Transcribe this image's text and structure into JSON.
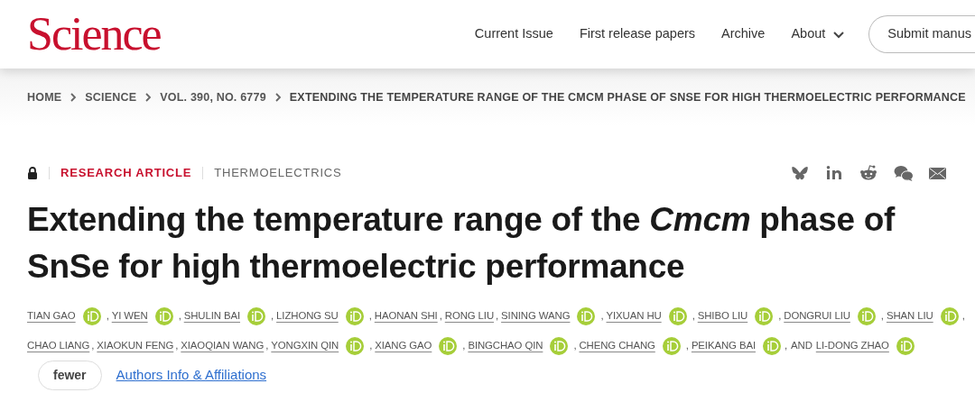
{
  "header": {
    "logo": "Science",
    "nav": [
      {
        "label": "Current Issue",
        "dropdown": false
      },
      {
        "label": "First release papers",
        "dropdown": false
      },
      {
        "label": "Archive",
        "dropdown": false
      },
      {
        "label": "About",
        "dropdown": true
      }
    ],
    "submit_button": "Submit manus"
  },
  "breadcrumb": [
    "HOME",
    "SCIENCE",
    "VOL. 390, NO. 6779",
    "EXTENDING THE TEMPERATURE RANGE OF THE CMCM PHASE OF SNSE FOR HIGH THERMOELECTRIC PERFORMANCE"
  ],
  "article": {
    "locked": true,
    "type": "RESEARCH ARTICLE",
    "subject": "THERMOELECTRICS",
    "share": [
      {
        "kind": "bluesky"
      },
      {
        "kind": "linkedin"
      },
      {
        "kind": "reddit"
      },
      {
        "kind": "wechat"
      },
      {
        "kind": "email"
      }
    ],
    "title": "Extending the temperature range of the *Cmcm* phase of SnSe for high thermoelectric performance",
    "authors": {
      "separator": ",",
      "conjunction": "AND",
      "lines": [
        [
          {
            "name": "TIAN GAO",
            "orcid": true
          },
          {
            "name": "YI WEN",
            "orcid": true
          },
          {
            "name": "SHULIN BAI",
            "orcid": true
          },
          {
            "name": "LIZHONG SU",
            "orcid": true
          },
          {
            "name": "HAONAN SHI",
            "orcid": false
          },
          {
            "name": "RONG LIU",
            "orcid": false
          },
          {
            "name": "SINING WANG",
            "orcid": true
          },
          {
            "name": "YIXUAN HU",
            "orcid": true
          },
          {
            "name": "SHIBO LIU",
            "orcid": true
          },
          {
            "name": "DONGRUI LIU",
            "orcid": true
          },
          {
            "name": "SHAN LIU",
            "orcid": true
          }
        ],
        [
          {
            "name": "CHAO LIANG",
            "orcid": false
          },
          {
            "name": "XIAOKUN FENG",
            "orcid": false
          },
          {
            "name": "XIAOQIAN WANG",
            "orcid": false
          },
          {
            "name": "YONGXIN QIN",
            "orcid": true
          },
          {
            "name": "XIANG GAO",
            "orcid": true
          },
          {
            "name": "BINGCHAO QIN",
            "orcid": true
          },
          {
            "name": "CHENG CHANG",
            "orcid": true
          },
          {
            "name": "PEIKANG BAI",
            "orcid": true
          },
          {
            "name": "LI-DONG ZHAO",
            "orcid": true
          }
        ]
      ]
    },
    "toggle_button": "fewer",
    "affiliations_link": "Authors Info & Affiliations"
  }
}
